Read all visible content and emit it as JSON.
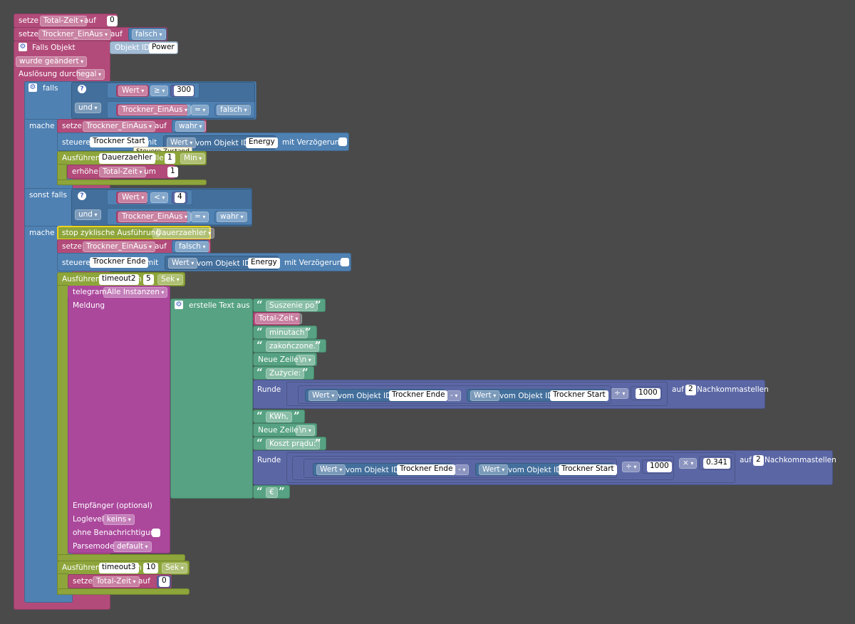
{
  "set_total_zero": {
    "kw": "setze",
    "var": "Total-Zeit",
    "op": "auf",
    "val": "0"
  },
  "set_trockner_false": {
    "kw": "setze",
    "var": "Trockner_EinAus",
    "op": "auf",
    "val": "falsch"
  },
  "on_object": {
    "kw": "Falls Objekt",
    "id_label": "Objekt ID",
    "id_value": "Power",
    "changed": "wurde geändert",
    "trigger_label": "Auslösung durch",
    "trigger_value": "egal"
  },
  "if_block": {
    "falls": "falls",
    "und": "und",
    "mache": "mache",
    "sonst_falls": "sonst falls",
    "c1": {
      "left": "Wert",
      "op": "≥",
      "right": "300"
    },
    "c2": {
      "left": "Trockner_EinAus",
      "op": "=",
      "right": "falsch"
    },
    "c3": {
      "left": "Wert",
      "op": "<",
      "right": "4"
    },
    "c4": {
      "left": "Trockner_EinAus",
      "op": "=",
      "right": "wahr"
    }
  },
  "do1": {
    "set_var": {
      "kw": "setze",
      "var": "Trockner_EinAus",
      "op": "auf",
      "val": "wahr"
    },
    "control": {
      "kw": "steuere",
      "target": "Trockner Start",
      "mit": "mit",
      "wert": "Wert",
      "from": "vom Objekt ID",
      "obj": "Energy",
      "delay": "mit Verzögerung"
    },
    "tooltip": "Steuere Zustand",
    "interval": {
      "kw": "Ausführen",
      "name": "Dauerzaehler",
      "alle": "alle",
      "n": "1",
      "unit": "Min"
    },
    "inc": {
      "kw": "erhöhe",
      "var": "Total-Zeit",
      "um": "um",
      "n": "1"
    }
  },
  "do2": {
    "stop": {
      "kw": "stop zyklische Ausführung",
      "name": "Dauerzaehler"
    },
    "set_var": {
      "kw": "setze",
      "var": "Trockner_EinAus",
      "op": "auf",
      "val": "falsch"
    },
    "control": {
      "kw": "steuere",
      "target": "Trockner Ende",
      "mit": "mit",
      "wert": "Wert",
      "from": "vom Objekt ID",
      "obj": "Energy",
      "delay": "mit Verzögerung"
    },
    "timeout2": {
      "kw": "Ausführen",
      "name": "timeout2",
      "in": "in",
      "n": "5",
      "unit": "Sek"
    },
    "telegram": {
      "kw": "telegram",
      "inst": "Alle Instanzen",
      "msg": "Meldung",
      "recv": "Empfänger (optional)",
      "loglevel": "Loglevel",
      "loglevel_val": "keins",
      "silent": "ohne Benachrichtigung",
      "parsemode": "Parsemode",
      "parsemode_val": "default"
    },
    "text": {
      "label": "erstelle Text aus",
      "t1": "Suszenie po",
      "var": "Total-Zeit",
      "t2": "minutach",
      "t3": "zakończone.",
      "nl": "Neue Zeile",
      "nl_val": "\\n",
      "t4": "Zużycie:",
      "t5": "KWh,",
      "t6": "Koszt prądu:",
      "t7": "€"
    },
    "round1": {
      "kw": "Runde",
      "wert": "Wert",
      "from": "vom Objekt ID",
      "a": "Trockner Ende",
      "minus": "-",
      "b": "Trockner Start",
      "div": "÷",
      "divisor": "1000",
      "auf": "auf",
      "digits": "2",
      "nach": "Nachkommastellen"
    },
    "round2": {
      "kw": "Runde",
      "wert": "Wert",
      "from": "vom Objekt ID",
      "a": "Trockner Ende",
      "minus": "-",
      "b": "Trockner Start",
      "div": "÷",
      "divisor": "1000",
      "mul": "×",
      "factor": "0.341",
      "auf": "auf",
      "digits": "2",
      "nach": "Nachkommastellen"
    },
    "timeout3": {
      "kw": "Ausführen",
      "name": "timeout3",
      "in": "in",
      "n": "10",
      "unit": "Sek"
    },
    "reset": {
      "kw": "setze",
      "var": "Total-Zeit",
      "op": "auf",
      "val": "0"
    }
  },
  "icons": {
    "gear": "gear-icon",
    "help": "help-icon",
    "dropdown": "chevron-down-icon"
  }
}
